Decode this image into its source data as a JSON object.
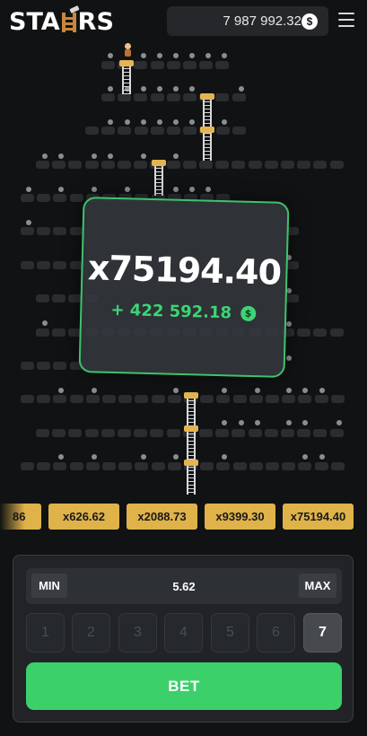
{
  "header": {
    "logo_text": "STAIRS",
    "balance": "7 987 992.32",
    "currency_symbol": "$"
  },
  "popup": {
    "multiplier": "x75194.40",
    "win_amount": "+ 422 592.18",
    "currency_symbol": "$"
  },
  "multipliers": {
    "partial": "86",
    "items": [
      "x626.62",
      "x2088.73",
      "x9399.30",
      "x75194.40"
    ]
  },
  "controls": {
    "min_label": "MIN",
    "max_label": "MAX",
    "stake": "5.62",
    "levels": [
      "1",
      "2",
      "3",
      "4",
      "5",
      "6",
      "7"
    ],
    "selected_level": "7",
    "bet_label": "BET"
  },
  "colors": {
    "background": "#111214",
    "accent_green": "#3cd06a",
    "gold": "#dfb24a",
    "platform": "#2b2d31"
  }
}
